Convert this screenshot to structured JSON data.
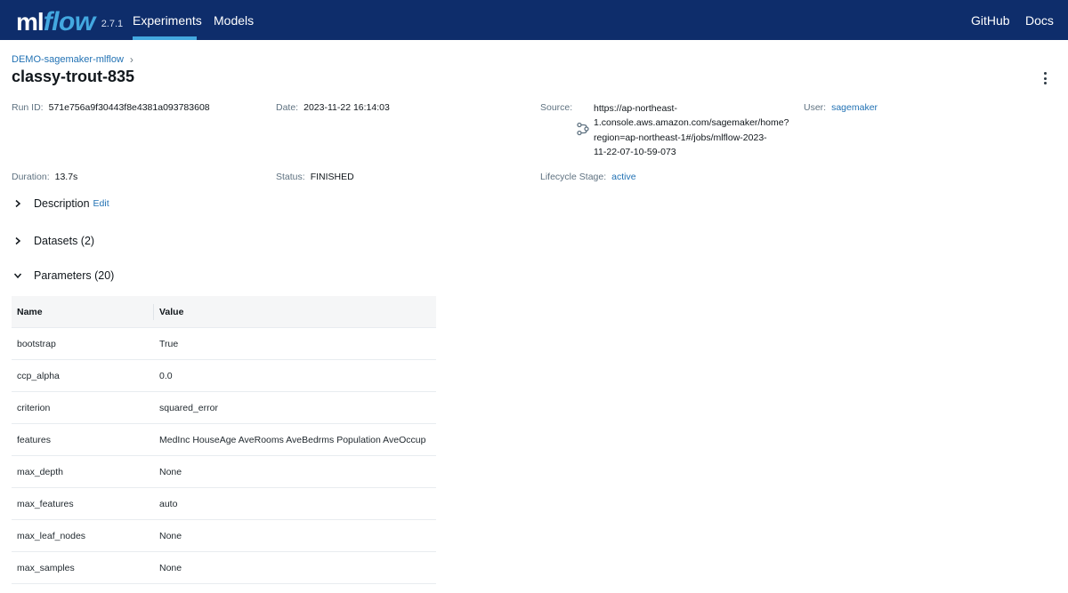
{
  "app": {
    "logo_ml": "ml",
    "logo_flow": "flow",
    "version": "2.7.1"
  },
  "nav": {
    "experiments": "Experiments",
    "models": "Models",
    "github": "GitHub",
    "docs": "Docs"
  },
  "breadcrumb": {
    "experiment": "DEMO-sagemaker-mlflow",
    "separator": "›"
  },
  "run": {
    "title": "classy-trout-835",
    "run_id_label": "Run ID:",
    "run_id": "571e756a9f30443f8e4381a093783608",
    "date_label": "Date:",
    "date": "2023-11-22 16:14:03",
    "source_label": "Source:",
    "source_lines": [
      "https://ap-northeast-",
      "1.console.aws.amazon.com/sagemaker/home?",
      "region=ap-northeast-1#/jobs/mlflow-2023-",
      "11-22-07-10-59-073"
    ],
    "source_icon": "git-branch-icon",
    "user_label": "User:",
    "user": "sagemaker",
    "duration_label": "Duration:",
    "duration": "13.7s",
    "status_label": "Status:",
    "status": "FINISHED",
    "lifecycle_label": "Lifecycle Stage:",
    "lifecycle": "active"
  },
  "sections": {
    "description": "Description",
    "edit": "Edit",
    "datasets": "Datasets (2)",
    "parameters": "Parameters (20)"
  },
  "params_table": {
    "headers": [
      "Name",
      "Value"
    ],
    "rows": [
      [
        "bootstrap",
        "True"
      ],
      [
        "ccp_alpha",
        "0.0"
      ],
      [
        "criterion",
        "squared_error"
      ],
      [
        "features",
        "MedInc HouseAge AveRooms AveBedrms Population AveOccup"
      ],
      [
        "max_depth",
        "None"
      ],
      [
        "max_features",
        "auto"
      ],
      [
        "max_leaf_nodes",
        "None"
      ],
      [
        "max_samples",
        "None"
      ]
    ]
  },
  "colors": {
    "nav_bg": "#0e2d6b",
    "accent": "#43a8e0",
    "link": "#2272b4"
  }
}
